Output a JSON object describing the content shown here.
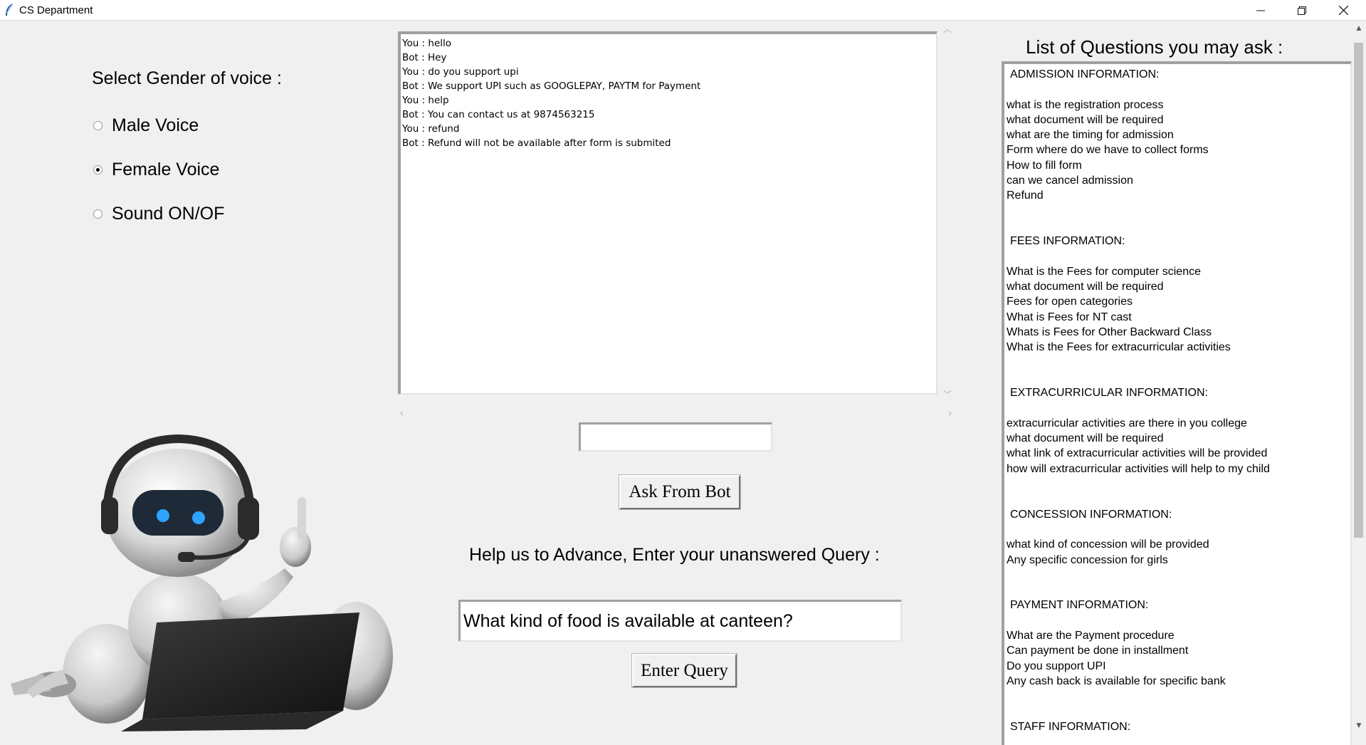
{
  "window": {
    "title": "CS Department",
    "controls": {
      "minimize": "—",
      "restore": "❐",
      "close": "✕"
    }
  },
  "voice": {
    "heading": "Select Gender of voice :",
    "options": [
      {
        "label": "Male Voice",
        "checked": false
      },
      {
        "label": "Female Voice",
        "checked": true
      },
      {
        "label": "Sound ON/OF",
        "checked": false
      }
    ]
  },
  "chat": {
    "lines": [
      "You : hello",
      "Bot : Hey",
      "You : do you support upi",
      "Bot : We support UPI such as GOOGLEPAY, PAYTM for Payment",
      "You : help",
      "Bot : You can contact us at 9874563215",
      "You : refund",
      "Bot : Refund will not be available after form is submited"
    ],
    "input_value": "",
    "ask_button": "Ask From Bot"
  },
  "query": {
    "heading": "Help us to Advance, Enter your unanswered Query :",
    "input_value": "What kind of food is available at canteen?",
    "enter_button": "Enter Query"
  },
  "questions": {
    "heading": "List of Questions you may ask :",
    "sections": [
      {
        "title": "ADMISSION INFORMATION:",
        "items": [
          "what is the registration process",
          "what document will be required",
          "what are the timing for admission",
          "Form where do we have to collect forms",
          "How to fill form",
          "can we cancel admission",
          "Refund"
        ]
      },
      {
        "title": "FEES INFORMATION:",
        "items": [
          "What is the Fees for computer science",
          "what document will be required",
          "Fees for open categories",
          "What is Fees for NT cast",
          "Whats is Fees for Other Backward Class",
          "What is the Fees for extracurricular activities"
        ]
      },
      {
        "title": "EXTRACURRICULAR INFORMATION:",
        "items": [
          "extracurricular activities are there in you college",
          "what document will be required",
          "what link of extracurricular activities will be provided",
          "how will extracurricular activities will help to my child"
        ]
      },
      {
        "title": "CONCESSION INFORMATION:",
        "items": [
          "what kind of concession will be provided",
          "Any specific concession for girls"
        ]
      },
      {
        "title": "PAYMENT INFORMATION:",
        "items": [
          "What are the Payment procedure",
          "Can payment be done in installment",
          "Do you support UPI",
          "Any cash back is available for specific bank"
        ]
      },
      {
        "title": "STAFF INFORMATION:",
        "items": []
      }
    ]
  }
}
